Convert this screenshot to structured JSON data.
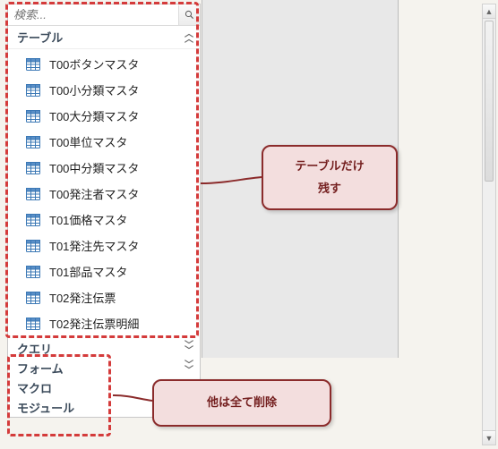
{
  "search": {
    "placeholder": "検索..."
  },
  "groups": {
    "tables": {
      "label": "テーブル",
      "items": [
        "T00ボタンマスタ",
        "T00小分類マスタ",
        "T00大分類マスタ",
        "T00単位マスタ",
        "T00中分類マスタ",
        "T00発注者マスタ",
        "T01価格マスタ",
        "T01発注先マスタ",
        "T01部品マスタ",
        "T02発注伝票",
        "T02発注伝票明細"
      ]
    },
    "others": [
      "クエリ",
      "フォーム",
      "マクロ",
      "モジュール"
    ]
  },
  "callouts": {
    "keep_line1": "テーブルだけ",
    "keep_line2": "残す",
    "delete": "他は全て削除"
  }
}
